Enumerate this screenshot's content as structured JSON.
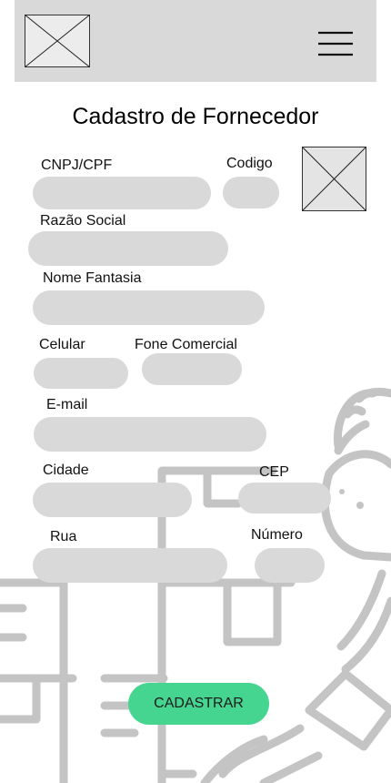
{
  "header": {
    "logo_icon": "image-placeholder-icon",
    "menu_icon": "hamburger-menu-icon",
    "background": "#d9d9d9"
  },
  "form": {
    "title": "Cadastro de Fornecedor",
    "photo_icon": "image-placeholder-icon",
    "fields": {
      "cnpj": {
        "label": "CNPJ/CPF",
        "value": "",
        "placeholder": ""
      },
      "codigo": {
        "label": "Codigo",
        "value": "",
        "placeholder": ""
      },
      "razao_social": {
        "label": "Razão Social",
        "value": "",
        "placeholder": ""
      },
      "nome_fantasia": {
        "label": "Nome Fantasia",
        "value": "",
        "placeholder": ""
      },
      "celular": {
        "label": "Celular",
        "value": "",
        "placeholder": ""
      },
      "fone_comercial": {
        "label": "Fone Comercial",
        "value": "",
        "placeholder": ""
      },
      "email": {
        "label": "E-mail",
        "value": "",
        "placeholder": ""
      },
      "cidade": {
        "label": "Cidade",
        "value": "",
        "placeholder": ""
      },
      "cep": {
        "label": "CEP",
        "value": "",
        "placeholder": ""
      },
      "rua": {
        "label": "Rua",
        "value": "",
        "placeholder": ""
      },
      "numero": {
        "label": "Número",
        "value": "",
        "placeholder": ""
      }
    },
    "submit_label": "CADASTRAR",
    "accent_color": "#45d591",
    "field_color": "#d9d9d9"
  },
  "background_illustration": "delivery-person-boxes-illustration"
}
